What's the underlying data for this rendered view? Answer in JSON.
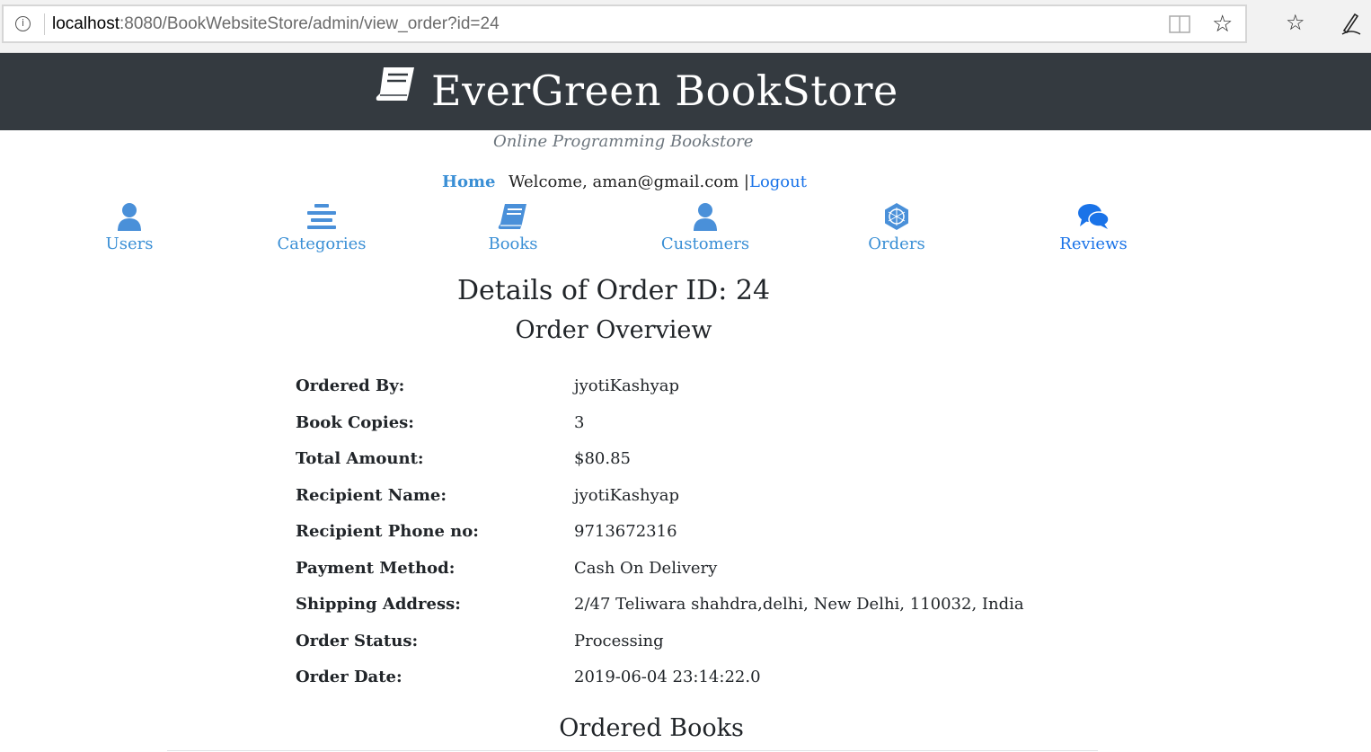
{
  "browser": {
    "url_host": "localhost",
    "url_rest": ":8080/BookWebsiteStore/admin/view_order?id=24",
    "icons": [
      "info-icon",
      "reader-view-icon",
      "star-icon",
      "favorites-icon",
      "pen-icon"
    ]
  },
  "header": {
    "title": "EverGreen BookStore",
    "tagline": "Online Programming Bookstore",
    "background": "#343a40"
  },
  "topbar": {
    "home_label": "Home",
    "welcome_text": "Welcome, aman@gmail.com |",
    "logout_label": "Logout"
  },
  "nav": {
    "users": "Users",
    "categories": "Categories",
    "books": "Books",
    "customers": "Customers",
    "orders": "Orders",
    "reviews": "Reviews"
  },
  "page": {
    "title": "Details of Order ID: 24",
    "overview_heading": "Order Overview",
    "ordered_books_heading": "Ordered Books"
  },
  "order": {
    "rows": [
      {
        "label": "Ordered By:",
        "value": "jyotiKashyap"
      },
      {
        "label": "Book Copies:",
        "value": "3"
      },
      {
        "label": "Total Amount:",
        "value": "$80.85"
      },
      {
        "label": "Recipient Name:",
        "value": "jyotiKashyap"
      },
      {
        "label": "Recipient Phone no:",
        "value": "9713672316"
      },
      {
        "label": "Payment Method:",
        "value": "Cash On Delivery"
      },
      {
        "label": "Shipping Address:",
        "value": "2/47 Teliwara shahdra,delhi, New Delhi, 110032, India"
      },
      {
        "label": "Order Status:",
        "value": "Processing"
      },
      {
        "label": "Order Date:",
        "value": "2019-06-04 23:14:22.0"
      }
    ]
  },
  "colors": {
    "link": "#3a8fd5",
    "icon": "#4a90d9"
  }
}
